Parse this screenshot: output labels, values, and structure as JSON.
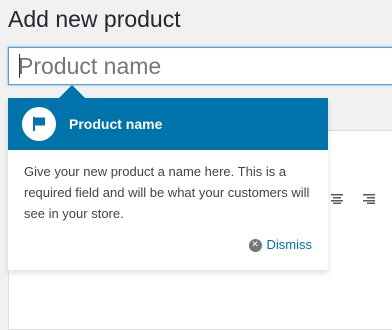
{
  "page": {
    "title": "Add new product"
  },
  "title_field": {
    "placeholder": "Product name",
    "value": ""
  },
  "tour": {
    "icon": "flag-icon",
    "title": "Product name",
    "body": "Give your new product a name here. This is a required field and will be what your customers will see in your store.",
    "dismiss_label": "Dismiss",
    "dismiss_icon": "close-circle-icon",
    "header_color": "#0073aa"
  },
  "editor_toolbar": {
    "visible_icons": [
      "align-center-icon",
      "align-right-icon"
    ]
  },
  "colors": {
    "accent": "#0073aa",
    "background": "#f1f1f1",
    "input_focus_border": "#5b9dd9"
  }
}
